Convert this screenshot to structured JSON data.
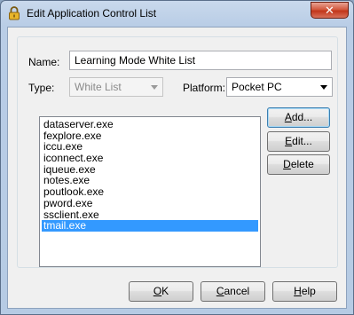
{
  "window": {
    "title": "Edit Application Control List",
    "close_glyph": "✕",
    "colors": {
      "selection": "#3399ff",
      "close": "#c2361b"
    }
  },
  "form": {
    "name_label": "Name:",
    "name_value": "Learning Mode White List",
    "type_label": "Type:",
    "type_value": "White List",
    "platform_label": "Platform:",
    "platform_value": "Pocket PC"
  },
  "list": {
    "items": [
      {
        "label": "dataserver.exe",
        "selected": false
      },
      {
        "label": "fexplore.exe",
        "selected": false
      },
      {
        "label": "iccu.exe",
        "selected": false
      },
      {
        "label": "iconnect.exe",
        "selected": false
      },
      {
        "label": "iqueue.exe",
        "selected": false
      },
      {
        "label": "notes.exe",
        "selected": false
      },
      {
        "label": "poutlook.exe",
        "selected": false
      },
      {
        "label": "pword.exe",
        "selected": false
      },
      {
        "label": "ssclient.exe",
        "selected": false
      },
      {
        "label": "tmail.exe",
        "selected": true
      }
    ]
  },
  "actions": {
    "add_accel": "A",
    "add_rest": "dd...",
    "edit_accel": "E",
    "edit_rest": "dit...",
    "delete_accel": "D",
    "delete_rest": "elete"
  },
  "footer": {
    "ok_accel": "O",
    "ok_rest": "K",
    "cancel_accel": "C",
    "cancel_rest": "ancel",
    "help_accel": "H",
    "help_rest": "elp"
  }
}
